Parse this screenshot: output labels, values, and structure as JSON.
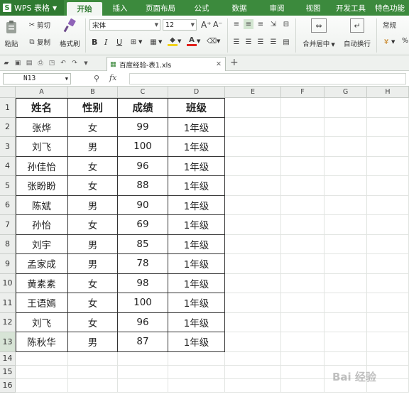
{
  "app": {
    "name": "WPS 表格"
  },
  "menu": {
    "tabs": [
      "开始",
      "插入",
      "页面布局",
      "公式",
      "数据",
      "审阅",
      "视图",
      "开发工具",
      "特色功能"
    ],
    "active_index": 0
  },
  "ribbon": {
    "paste": "粘贴",
    "cut": "剪切",
    "copy": "复制",
    "format_painter": "格式刷",
    "font_name": "宋体",
    "font_size": "12",
    "bold": "B",
    "italic": "I",
    "underline": "U",
    "merge_center": "合并居中",
    "wrap_text": "自动换行",
    "number_format": "常规",
    "percent": "%"
  },
  "document": {
    "tab_title": "百度经验-表1.xls"
  },
  "formula_bar": {
    "cell_ref": "N13",
    "fx": "fx",
    "formula": ""
  },
  "sheet": {
    "columns": [
      "A",
      "B",
      "C",
      "D",
      "E",
      "F",
      "G",
      "H"
    ],
    "row_numbers": [
      "1",
      "2",
      "3",
      "4",
      "5",
      "6",
      "7",
      "8",
      "9",
      "10",
      "11",
      "12",
      "13",
      "14",
      "15",
      "16"
    ],
    "header": [
      "姓名",
      "性别",
      "成绩",
      "班级"
    ],
    "rows": [
      [
        "张烨",
        "女",
        "99",
        "1年级"
      ],
      [
        "刘飞",
        "男",
        "100",
        "1年级"
      ],
      [
        "孙佳怡",
        "女",
        "96",
        "1年级"
      ],
      [
        "张盼盼",
        "女",
        "88",
        "1年级"
      ],
      [
        "陈斌",
        "男",
        "90",
        "1年级"
      ],
      [
        "孙怡",
        "女",
        "69",
        "1年级"
      ],
      [
        "刘宇",
        "男",
        "85",
        "1年级"
      ],
      [
        "孟家成",
        "男",
        "78",
        "1年级"
      ],
      [
        "黄素素",
        "女",
        "98",
        "1年级"
      ],
      [
        "王语嫣",
        "女",
        "100",
        "1年级"
      ],
      [
        "刘飞",
        "女",
        "96",
        "1年级"
      ],
      [
        "陈秋华",
        "男",
        "87",
        "1年级"
      ]
    ]
  },
  "colors": {
    "accent": "#3c8a3d",
    "selection": "#2e7d32"
  }
}
